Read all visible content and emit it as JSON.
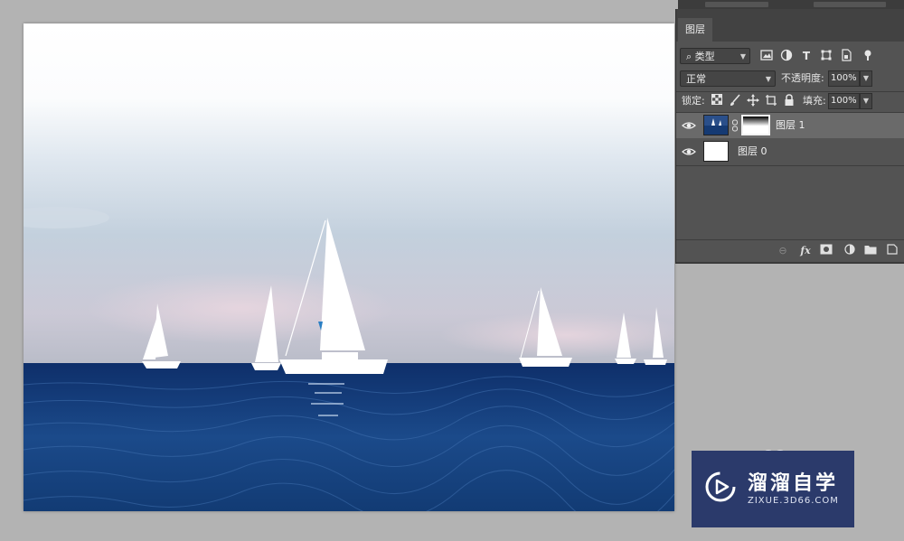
{
  "canvas": {
    "image_description_icon": "sailboats-on-sea-photo"
  },
  "layers_panel": {
    "tab_label": "图层",
    "filter": {
      "label": "类型"
    },
    "blend_mode": {
      "value": "正常"
    },
    "opacity": {
      "label": "不透明度:",
      "value": "100%"
    },
    "lock": {
      "label": "锁定:"
    },
    "fill": {
      "label": "填充:",
      "value": "100%"
    },
    "layers": [
      {
        "name": "图层 1",
        "selected": true,
        "has_mask": true
      },
      {
        "name": "图层 0",
        "selected": false,
        "has_mask": false
      }
    ],
    "colors": {
      "panel_bg": "#535353",
      "selected_row": "#6a6a6a",
      "tab_bar": "#424242"
    }
  },
  "watermark": {
    "title": "溜溜自学",
    "url": "ZIXUE.3D66.COM",
    "bg_color": "#2b3a6b"
  }
}
